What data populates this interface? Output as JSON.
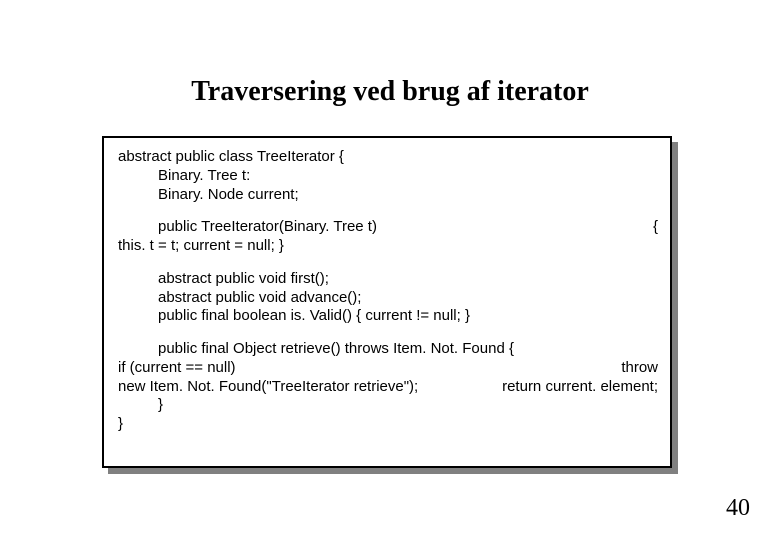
{
  "title": "Traversering ved brug af iterator",
  "code": {
    "b1_l1": "abstract public class TreeIterator {",
    "b1_l2": "Binary. Tree t:",
    "b1_l3": "Binary. Node current;",
    "b2_l1_left": "public TreeIterator(Binary. Tree t)",
    "b2_l1_right": "{",
    "b2_l2": "this. t = t; current = null; }",
    "b3_l1": "abstract public void first();",
    "b3_l2": "abstract public void advance();",
    "b3_l3": "public final boolean is. Valid() { current != null; }",
    "b4_l1": "public final Object retrieve() throws Item. Not. Found {",
    "b4_l2_left": "if (current == null)",
    "b4_l2_right": "throw",
    "b4_l3_left": "new Item. Not. Found(\"TreeIterator retrieve\");",
    "b4_l3_right": "return current. element;",
    "b4_l4": "}",
    "b4_l5": "}"
  },
  "page_number": "40"
}
